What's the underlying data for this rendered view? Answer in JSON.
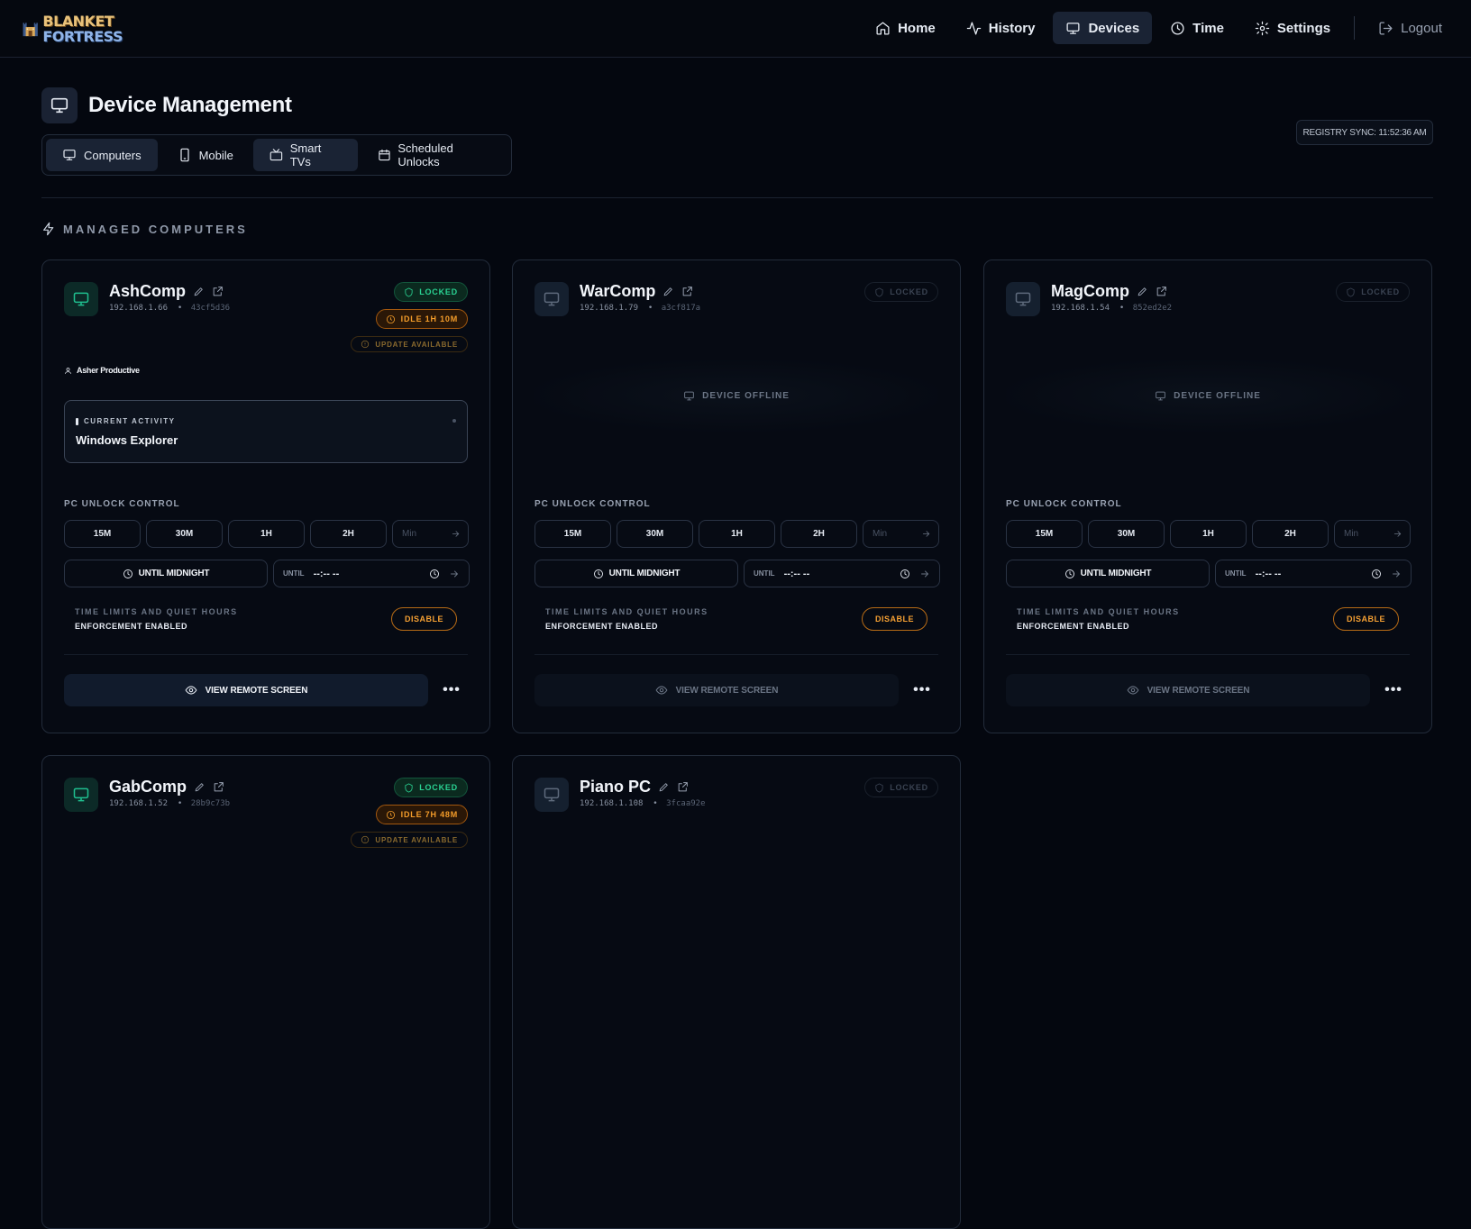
{
  "app": {
    "logo_line1": "BLANKET",
    "logo_line2": "FORTRESS"
  },
  "nav": {
    "home": "Home",
    "history": "History",
    "devices": "Devices",
    "time": "Time",
    "settings": "Settings",
    "logout": "Logout"
  },
  "header": {
    "title": "Device Management",
    "sync": "REGISTRY SYNC: 11:52:36 AM"
  },
  "tabs": {
    "computers": "Computers",
    "mobile": "Mobile",
    "smart_tvs": "Smart TVs",
    "scheduled": "Scheduled Unlocks"
  },
  "section": "MANAGED COMPUTERS",
  "common": {
    "locked": "LOCKED",
    "update": "UPDATE AVAILABLE",
    "current_activity": "CURRENT ACTIVITY",
    "device_offline": "DEVICE OFFLINE",
    "pc_unlock": "PC UNLOCK CONTROL",
    "q15": "15M",
    "q30": "30M",
    "q1h": "1H",
    "q2h": "2H",
    "min_placeholder": "Min",
    "until_midnight": "UNTIL MIDNIGHT",
    "until": "UNTIL",
    "time_placeholder": "--:-- --",
    "limits": "TIME LIMITS AND QUIET HOURS",
    "enforcement": "ENFORCEMENT ENABLED",
    "disable": "DISABLE",
    "view_remote": "VIEW REMOTE SCREEN",
    "more": "•••"
  },
  "devices": [
    {
      "name": "AshComp",
      "ip": "192.168.1.66",
      "hash": "43cf5d36",
      "idle": "IDLE 1H 10M",
      "user": "Asher Productive",
      "activity": "Windows Explorer"
    },
    {
      "name": "WarComp",
      "ip": "192.168.1.79",
      "hash": "a3cf817a"
    },
    {
      "name": "MagComp",
      "ip": "192.168.1.54",
      "hash": "852ed2e2"
    },
    {
      "name": "GabComp",
      "ip": "192.168.1.52",
      "hash": "28b9c73b",
      "idle": "IDLE 7H 48M"
    },
    {
      "name": "Piano PC",
      "ip": "192.168.1.108",
      "hash": "3fcaa92e"
    }
  ],
  "colors": {
    "accent_green": "#2ad393",
    "accent_orange": "#f59d2a",
    "background": "#04070f"
  }
}
